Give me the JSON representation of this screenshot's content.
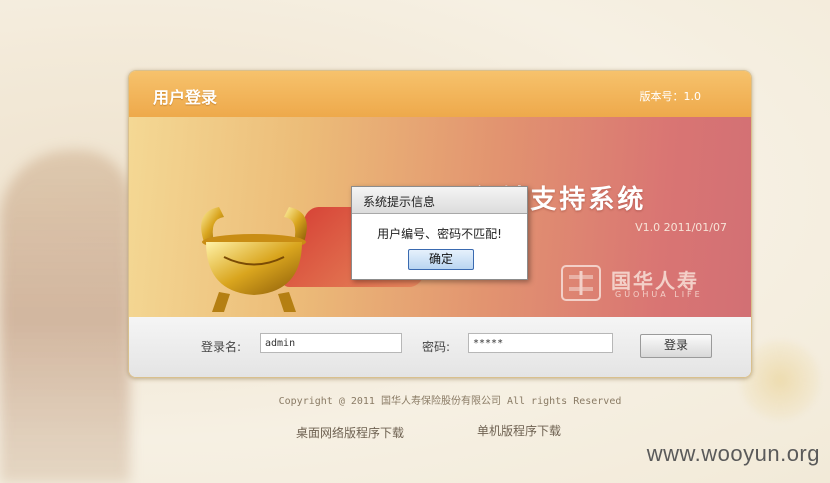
{
  "login": {
    "title": "用户登录",
    "version_label": "版本号：1.0"
  },
  "banner": {
    "system_title": "IT行销支持系统",
    "system_version": "V1.0 2011/01/07",
    "logo_cn": "国华人寿",
    "logo_en": "GUOHUA LIFE"
  },
  "form": {
    "username_label": "登录名:",
    "username_value": "admin",
    "password_label": "密码:",
    "password_value": "*****",
    "login_button": "登录"
  },
  "footer": {
    "copyright": "Copyright @ 2011 国华人寿保险股份有限公司 All rights Reserved",
    "download_desktop": "桌面网络版程序下载",
    "download_standalone": "单机版程序下载"
  },
  "dialog": {
    "title": "系统提示信息",
    "message": "用户编号、密码不匹配!",
    "ok_button": "确定"
  },
  "watermark": "www.wooyun.org",
  "colors": {
    "header_orange": "#eea94b",
    "banner_red": "#d27074",
    "ok_button_blue": "#b9d5f1"
  }
}
